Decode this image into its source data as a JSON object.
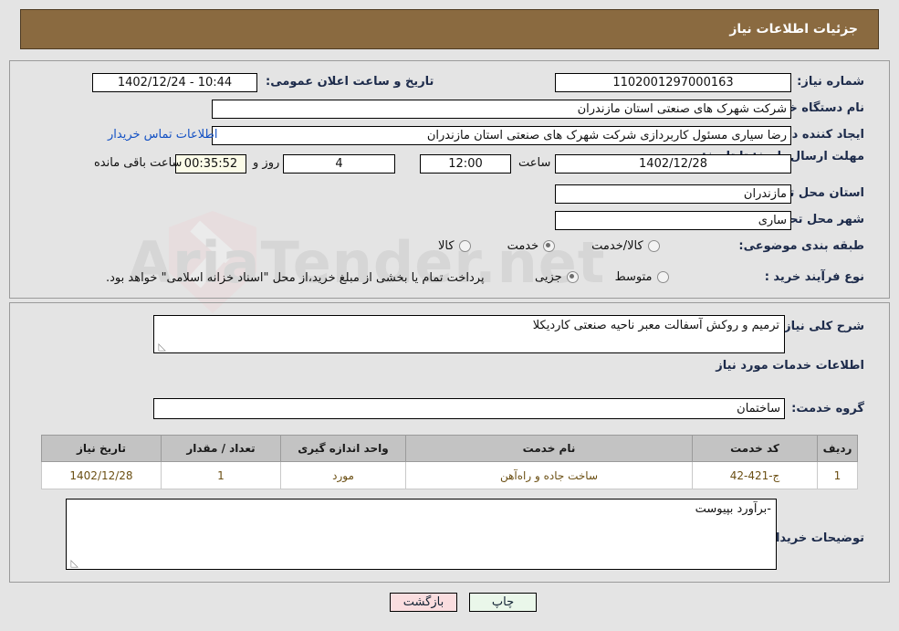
{
  "header": {
    "title": "جزئیات اطلاعات نیاز"
  },
  "watermark": {
    "text": "AriaTender.net"
  },
  "top_panel": {
    "need_number_label": "شماره نیاز:",
    "need_number_value": "1102001297000163",
    "announce_datetime_label": "تاریخ و ساعت اعلان عمومی:",
    "announce_datetime_value": "10:44 - 1402/12/24",
    "buyer_org_label": "نام دستگاه خریدار:",
    "buyer_org_value": "شرکت شهرک های صنعتی استان مازندران",
    "creator_label": "ایجاد کننده درخواست:",
    "creator_value": "رضا سیاری مسئول کاربردازی شرکت شهرک های صنعتی استان مازندران",
    "contact_link": "اطلاعات تماس خریدار",
    "deadline_label": "مهلت ارسال پاسخ: تا تاریخ:",
    "deadline_date": "1402/12/28",
    "hour_label": "ساعت",
    "hour_value": "12:00",
    "days_value": "4",
    "days_suffix": "روز و",
    "countdown_value": "00:35:52",
    "countdown_suffix": "ساعت باقی مانده",
    "province_label": "استان محل تحویل:",
    "province_value": "مازندران",
    "city_label": "شهر محل تحویل:",
    "city_value": "ساری",
    "category_label": "طبقه بندی موضوعی:",
    "category_options": [
      {
        "label": "کالا",
        "selected": false
      },
      {
        "label": "خدمت",
        "selected": true
      },
      {
        "label": "کالا/خدمت",
        "selected": false
      }
    ],
    "purchase_type_label": "نوع فرآیند خرید :",
    "purchase_type_options": [
      {
        "label": "جزیی",
        "selected": true
      },
      {
        "label": "متوسط",
        "selected": false
      }
    ],
    "treasury_note": "پرداخت تمام یا بخشی از مبلغ خرید،از محل \"اسناد خزانه اسلامی\" خواهد بود."
  },
  "mid_panel": {
    "general_desc_label": "شرح کلی نیاز:",
    "general_desc_value": "ترمیم و روکش آسفالت معبر ناحیه صنعتی کاردیکلا",
    "services_heading": "اطلاعات خدمات مورد نیاز",
    "service_group_label": "گروه خدمت:",
    "service_group_value": "ساختمان",
    "table": {
      "columns": [
        "ردیف",
        "کد خدمت",
        "نام خدمت",
        "واحد اندازه گیری",
        "تعداد / مقدار",
        "تاریخ نیاز"
      ],
      "rows": [
        [
          "1",
          "ج-421-42",
          "ساخت جاده و راه‌آهن",
          "مورد",
          "1",
          "1402/12/28"
        ]
      ]
    },
    "buyer_notes_label": "توضیحات خریدار:",
    "buyer_notes_value": "-برآورد بپیوست"
  },
  "footer": {
    "print_label": "چاپ",
    "back_label": "بازگشت"
  },
  "colors": {
    "header_bg": "#8a6a40",
    "page_bg": "#e4e4e4",
    "label": "#1c2a4a",
    "link": "#1351c4",
    "table_header_bg": "#c3c3c3",
    "table_cell_text": "#6b4f13",
    "timer_bg": "#fbfbe8",
    "print_btn_bg": "#eaf7ea",
    "back_btn_bg": "#fadddf"
  }
}
